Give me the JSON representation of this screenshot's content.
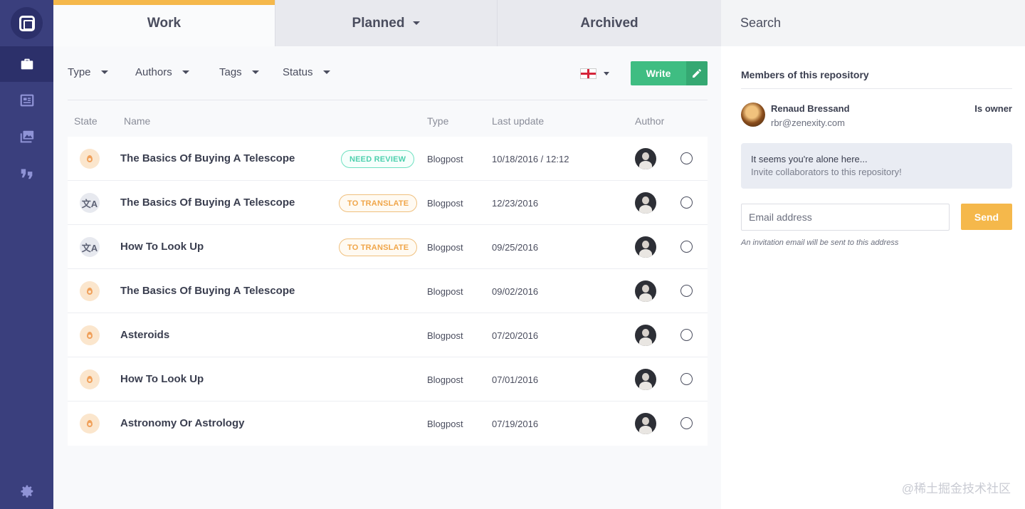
{
  "sidebar": {
    "logo_icon": "repository-logo-icon",
    "items": [
      {
        "icon": "briefcase-icon",
        "active": true
      },
      {
        "icon": "newspaper-icon",
        "active": false
      },
      {
        "icon": "images-icon",
        "active": false
      },
      {
        "icon": "quote-icon",
        "active": false
      }
    ],
    "settings_icon": "gear-icon"
  },
  "tabs": [
    {
      "label": "Work",
      "active": true
    },
    {
      "label": "Planned",
      "has_dropdown": true
    },
    {
      "label": "Archived"
    }
  ],
  "search": {
    "label": "Search"
  },
  "filters": {
    "type": "Type",
    "authors": "Authors",
    "tags": "Tags",
    "status": "Status",
    "language_flag": "england-flag-icon"
  },
  "write_button": {
    "label": "Write",
    "icon": "pencil-icon"
  },
  "table": {
    "headers": {
      "state": "State",
      "name": "Name",
      "type": "Type",
      "last_update": "Last update",
      "author": "Author"
    },
    "rows": [
      {
        "state_icon": "draft-drop-icon",
        "name": "The Basics Of Buying A Telescope",
        "badge": "NEED REVIEW",
        "type": "Blogpost",
        "date": "10/18/2016  / 12:12"
      },
      {
        "state_icon": "translate-icon",
        "name": "The Basics Of Buying A Telescope",
        "badge": "TO TRANSLATE",
        "type": "Blogpost",
        "date": "12/23/2016"
      },
      {
        "state_icon": "translate-icon",
        "name": "How To Look Up",
        "badge": "TO TRANSLATE",
        "type": "Blogpost",
        "date": "09/25/2016"
      },
      {
        "state_icon": "draft-drop-icon",
        "name": "The Basics Of Buying A Telescope",
        "badge": "",
        "type": "Blogpost",
        "date": "09/02/2016"
      },
      {
        "state_icon": "draft-drop-icon",
        "name": "Asteroids",
        "badge": "",
        "type": "Blogpost",
        "date": "07/20/2016"
      },
      {
        "state_icon": "draft-drop-icon",
        "name": "How To Look Up",
        "badge": "",
        "type": "Blogpost",
        "date": "07/01/2016"
      },
      {
        "state_icon": "draft-drop-icon",
        "name": "Astronomy Or Astrology",
        "badge": "",
        "type": "Blogpost",
        "date": "07/19/2016"
      }
    ]
  },
  "members": {
    "title": "Members of this repository",
    "member_name": "Renaud Bressand",
    "member_email": "rbr@zenexity.com",
    "member_role": "Is owner",
    "alone_line1": "It seems you're alone here...",
    "alone_line2": "Invite collaborators to this repository!",
    "email_placeholder": "Email address",
    "send_label": "Send",
    "hint": "An invitation email will be sent to this address"
  },
  "watermark": "@稀土掘金技术社区",
  "colors": {
    "sidebar": "#3a3f7d",
    "accent": "#f5b84b",
    "write": "#3fbd82"
  }
}
